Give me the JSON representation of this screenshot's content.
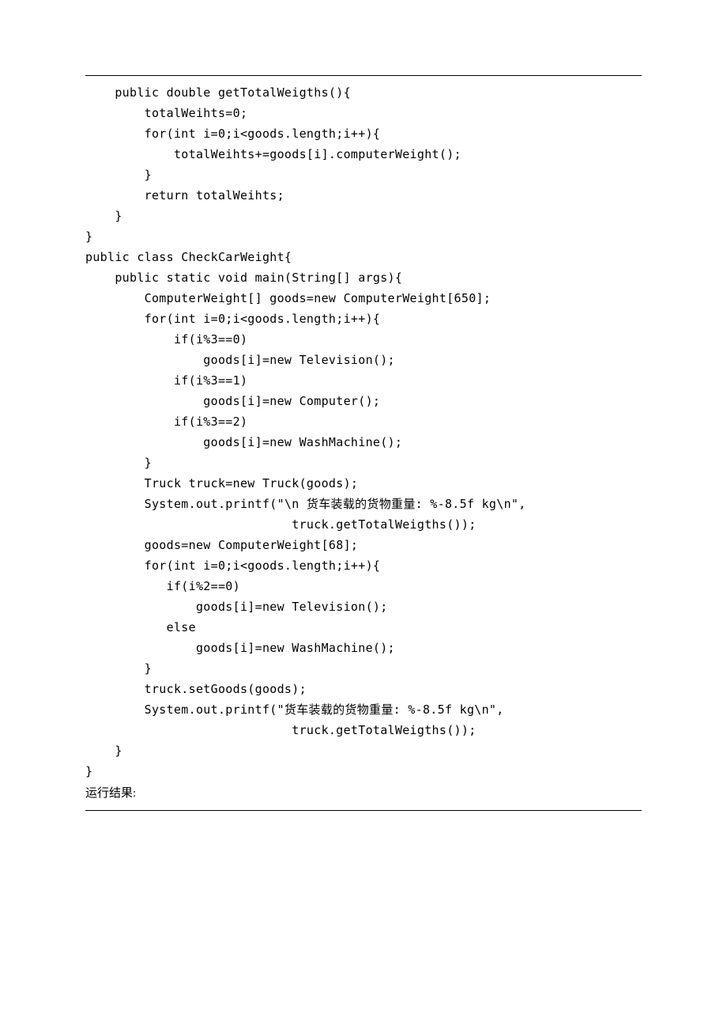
{
  "code": {
    "l1": "    public double getTotalWeigths(){",
    "l2": "        totalWeihts=0;",
    "l3": "        for(int i=0;i<goods.length;i++){",
    "l4": "            totalWeihts+=goods[i].computerWeight();",
    "l5": "        }",
    "l6": "        return totalWeihts;",
    "l7": "    }",
    "l8": "}",
    "l9": "public class CheckCarWeight{",
    "l10": "    public static void main(String[] args){",
    "l11": "        ComputerWeight[] goods=new ComputerWeight[650];",
    "l12": "        for(int i=0;i<goods.length;i++){",
    "l13": "            if(i%3==0)",
    "l14": "                goods[i]=new Television();",
    "l15": "            if(i%3==1)",
    "l16": "                goods[i]=new Computer();",
    "l17": "            if(i%3==2)",
    "l18": "                goods[i]=new WashMachine();",
    "l19": "        }",
    "l20": "        Truck truck=new Truck(goods);",
    "l21": "        System.out.printf(\"\\n 货车装载的货物重量: %-8.5f kg\\n\",",
    "l22": "                            truck.getTotalWeigths());",
    "l23": "        goods=new ComputerWeight[68];",
    "l24": "        for(int i=0;i<goods.length;i++){",
    "l25": "           if(i%2==0)",
    "l26": "               goods[i]=new Television();",
    "l27": "           else",
    "l28": "               goods[i]=new WashMachine();",
    "l29": "        }",
    "l30": "        truck.setGoods(goods);",
    "l31": "        System.out.printf(\"货车装载的货物重量: %-8.5f kg\\n\",",
    "l32": "                            truck.getTotalWeigths());",
    "l33": "    }",
    "l34": "}"
  },
  "footer": "运行结果:"
}
